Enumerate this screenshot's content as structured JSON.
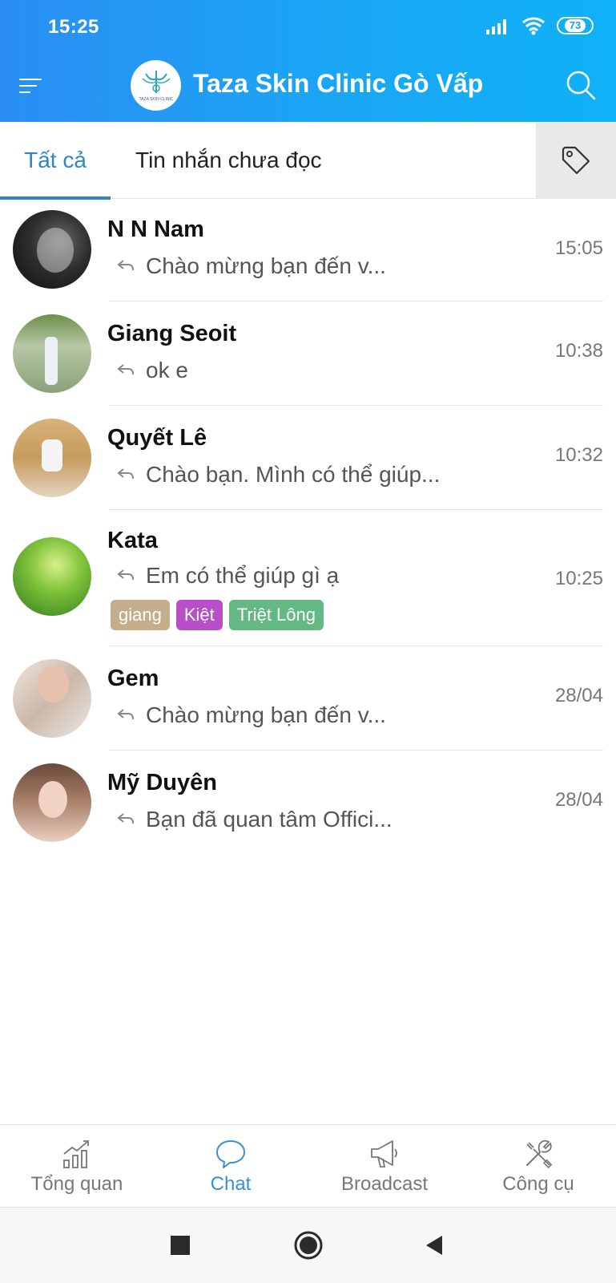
{
  "status_bar": {
    "time": "15:25",
    "battery": "73"
  },
  "header": {
    "title": "Taza Skin Clinic Gò Vấp",
    "logo_text": "TAZA SKIN CLINIC"
  },
  "tabs": {
    "all": "Tất cả",
    "unread": "Tin nhắn chưa đọc"
  },
  "colors": {
    "accent": "#2f86c7",
    "header_start": "#2a8ef4",
    "header_end": "#0fb2f6"
  },
  "chats": [
    {
      "name": "N N Nam",
      "preview": "Chào mừng bạn đến v...",
      "time": "15:05"
    },
    {
      "name": "Giang Seoit",
      "preview": "ok e",
      "time": "10:38"
    },
    {
      "name": "Quyết Lê",
      "preview": "Chào bạn. Mình có thể giúp...",
      "time": "10:32"
    },
    {
      "name": "Kata",
      "preview": "Em có thể giúp gì ạ",
      "time": "10:25",
      "labels": [
        {
          "text": "giang",
          "color": "#c4ad8a"
        },
        {
          "text": "Kiệt",
          "color": "#b84fc9"
        },
        {
          "text": "Triệt Lông",
          "color": "#63b884"
        }
      ]
    },
    {
      "name": "Gem",
      "preview": "Chào mừng bạn đến v...",
      "time": "28/04"
    },
    {
      "name": "Mỹ Duyên",
      "preview": "Bạn đã quan tâm Offici...",
      "time": "28/04"
    }
  ],
  "bottom_nav": {
    "overview": "Tổng quan",
    "chat": "Chat",
    "broadcast": "Broadcast",
    "tools": "Công cụ"
  }
}
